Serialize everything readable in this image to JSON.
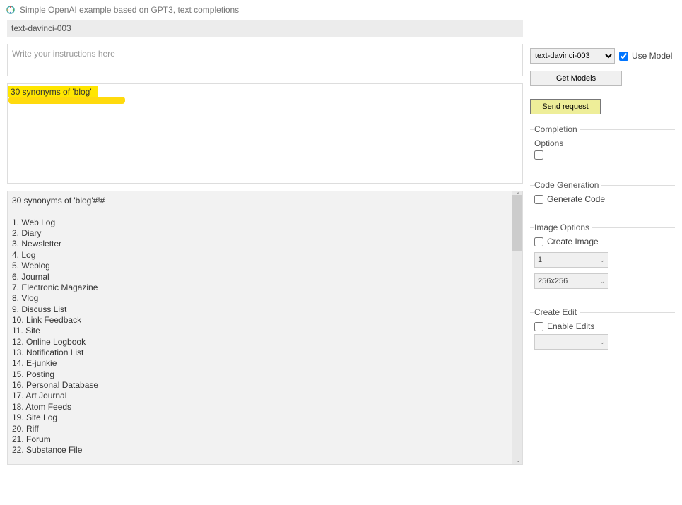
{
  "window": {
    "title": "Simple OpenAI example based on GPT3, text completions"
  },
  "left": {
    "model_label": "text-davinci-003",
    "instructions_placeholder": "Write your instructions here",
    "prompt": "30 synonyms of 'blog'",
    "output": "30 synonyms of 'blog'#!#\n\n1. Web Log\n2. Diary\n3. Newsletter\n4. Log\n5. Weblog\n6. Journal\n7. Electronic Magazine\n8. Vlog\n9. Discuss List\n10. Link Feedback\n11. Site\n12. Online Logbook\n13. Notification List\n14. E-junkie\n15. Posting\n16. Personal Database\n17. Art Journal\n18. Atom Feeds\n19. Site Log\n20. Riff\n21. Forum\n22. Substance File"
  },
  "right": {
    "model_select": "text-davinci-003",
    "use_model_label": "Use Model",
    "use_model_checked": true,
    "get_models": "Get Models",
    "send_request": "Send request",
    "completion": {
      "legend": "Completion",
      "options_label": "Options"
    },
    "codegen": {
      "legend": "Code Generation",
      "generate_code": "Generate Code"
    },
    "image": {
      "legend": "Image Options",
      "create_image": "Create Image",
      "count": "1",
      "size": "256x256"
    },
    "edit": {
      "legend": "Create Edit",
      "enable_edits": "Enable Edits"
    }
  }
}
